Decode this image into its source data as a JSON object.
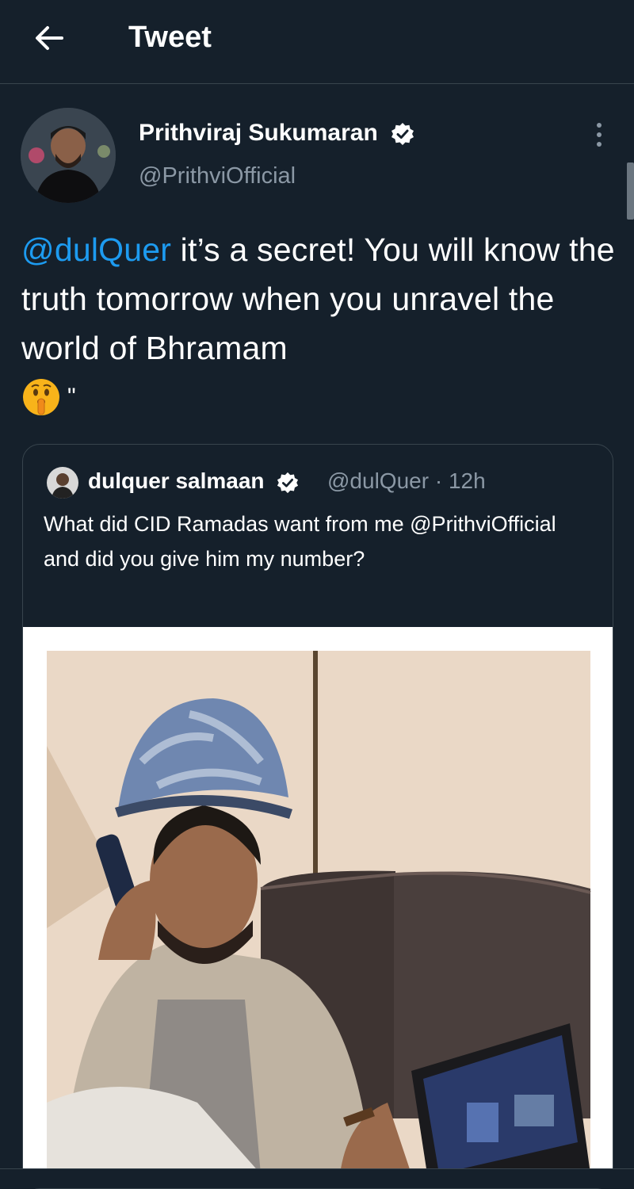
{
  "header": {
    "title": "Tweet"
  },
  "tweet": {
    "author_name": "Prithviraj Sukumaran",
    "author_handle": "@PrithviOfficial",
    "mention": "@dulQuer",
    "body": " it’s a secret! You will know the truth tomorrow when you unravel the world of Bhramam",
    "trailing": "\"",
    "emoji": "shushing-face-emoji"
  },
  "quoted": {
    "name": "dulquer salmaan",
    "handle": "@dulQuer",
    "separator": "·",
    "time": "12h",
    "text": "What did CID Ramadas want from me @PrithviOfficial and did you give him my number?"
  },
  "icons": {
    "back": "arrow-left-icon",
    "more": "more-vertical-icon",
    "verified": "verified-badge-icon"
  },
  "colors": {
    "background": "#15202b",
    "accent": "#1d9bf0",
    "secondary_text": "#8b98a5",
    "border": "#38444d"
  }
}
